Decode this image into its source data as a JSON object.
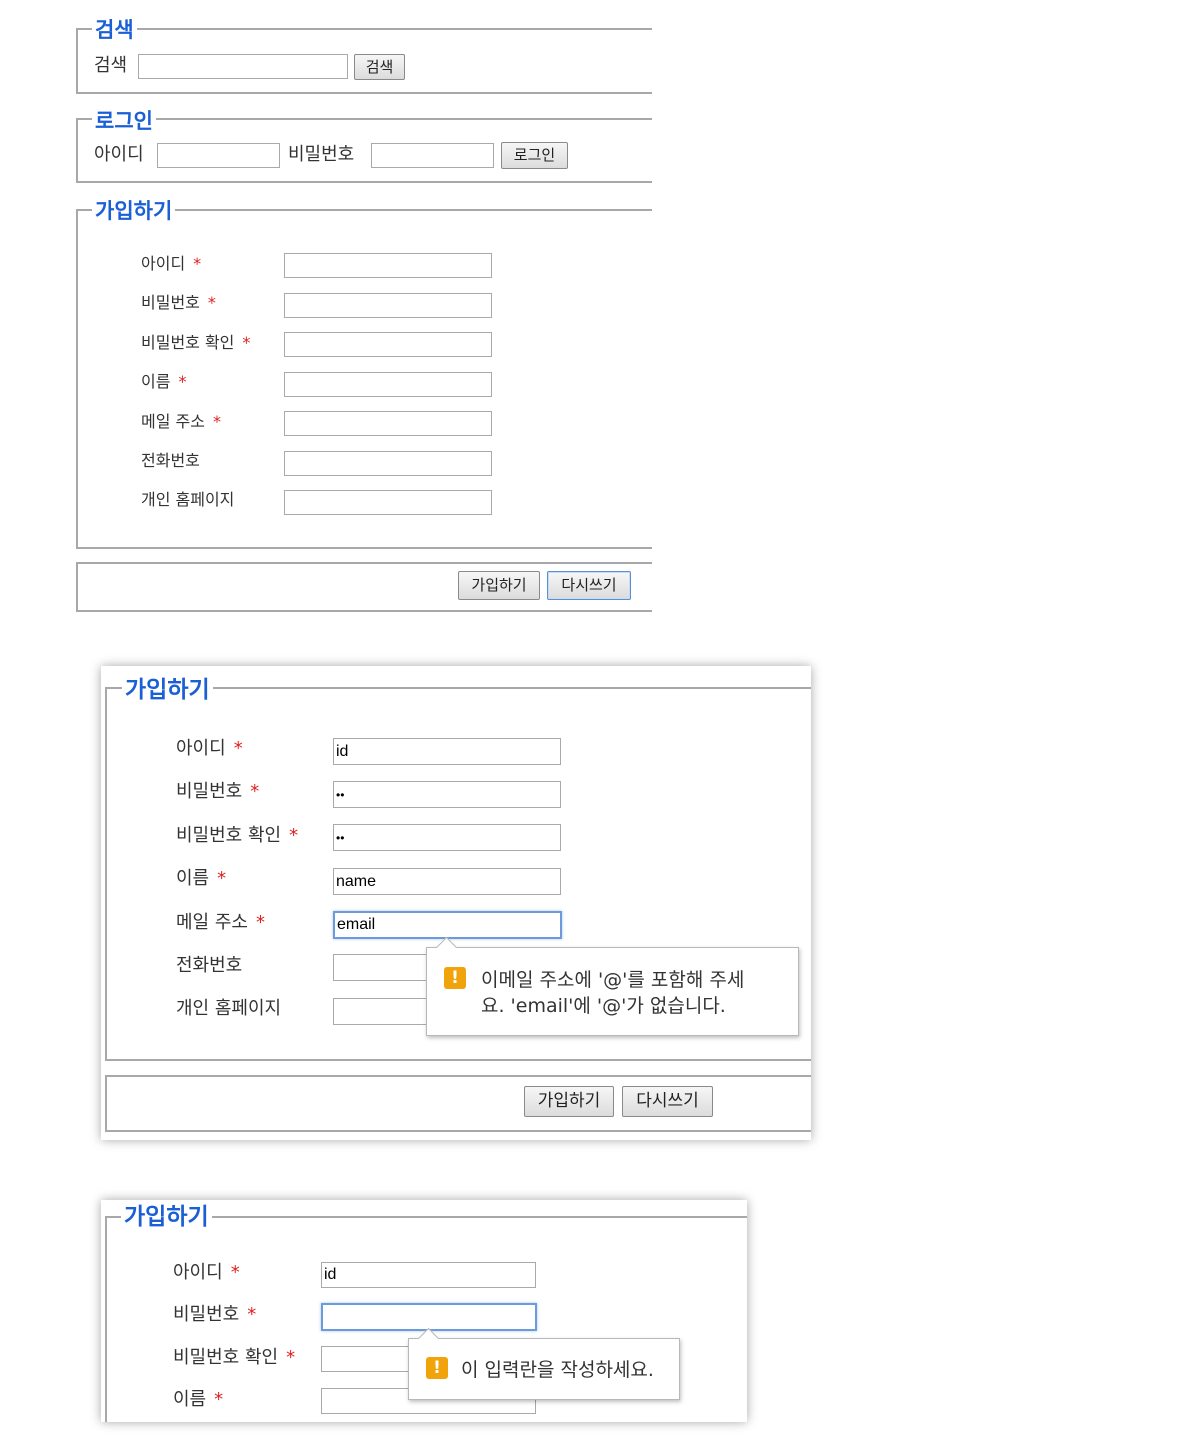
{
  "panel1": {
    "search": {
      "legend": "검색",
      "label": "검색",
      "value": "",
      "button": "검색"
    },
    "login": {
      "legend": "로그인",
      "id_label": "아이디",
      "id_value": "",
      "pw_label": "비밀번호",
      "pw_value": "",
      "button": "로그인"
    },
    "signup": {
      "legend": "가입하기",
      "fields": [
        {
          "label": "아이디",
          "required": "*",
          "value": ""
        },
        {
          "label": "비밀번호",
          "required": "*",
          "value": ""
        },
        {
          "label": "비밀번호 확인",
          "required": "*",
          "value": ""
        },
        {
          "label": "이름",
          "required": "*",
          "value": ""
        },
        {
          "label": "메일 주소",
          "required": "*",
          "value": ""
        },
        {
          "label": "전화번호",
          "required": "",
          "value": ""
        },
        {
          "label": "개인 홈페이지",
          "required": "",
          "value": ""
        }
      ]
    },
    "actions": {
      "submit": "가입하기",
      "reset": "다시쓰기"
    }
  },
  "panel2": {
    "legend": "가입하기",
    "fields": [
      {
        "label": "아이디",
        "required": "*",
        "value": "id"
      },
      {
        "label": "비밀번호",
        "required": "*",
        "value": "••"
      },
      {
        "label": "비밀번호 확인",
        "required": "*",
        "value": "••"
      },
      {
        "label": "이름",
        "required": "*",
        "value": "name"
      },
      {
        "label": "메일 주소",
        "required": "*",
        "value": "email"
      },
      {
        "label": "전화번호",
        "required": "",
        "value": ""
      },
      {
        "label": "개인 홈페이지",
        "required": "",
        "value": ""
      }
    ],
    "tooltip": {
      "icon": "!",
      "line1": "이메일 주소에 '@'를 포함해 주세",
      "line2": "요. 'email'에 '@'가 없습니다."
    },
    "actions": {
      "submit": "가입하기",
      "reset": "다시쓰기"
    }
  },
  "panel3": {
    "legend": "가입하기",
    "fields": [
      {
        "label": "아이디",
        "required": "*",
        "value": "id"
      },
      {
        "label": "비밀번호",
        "required": "*",
        "value": ""
      },
      {
        "label": "비밀번호 확인",
        "required": "*",
        "value": ""
      },
      {
        "label": "이름",
        "required": "*",
        "value": ""
      }
    ],
    "tooltip": {
      "icon": "!",
      "text": "이 입력란을 작성하세요."
    }
  },
  "colors": {
    "legend": "#1a5fd6",
    "required": "#e02020",
    "warning": "#f0a30a"
  }
}
